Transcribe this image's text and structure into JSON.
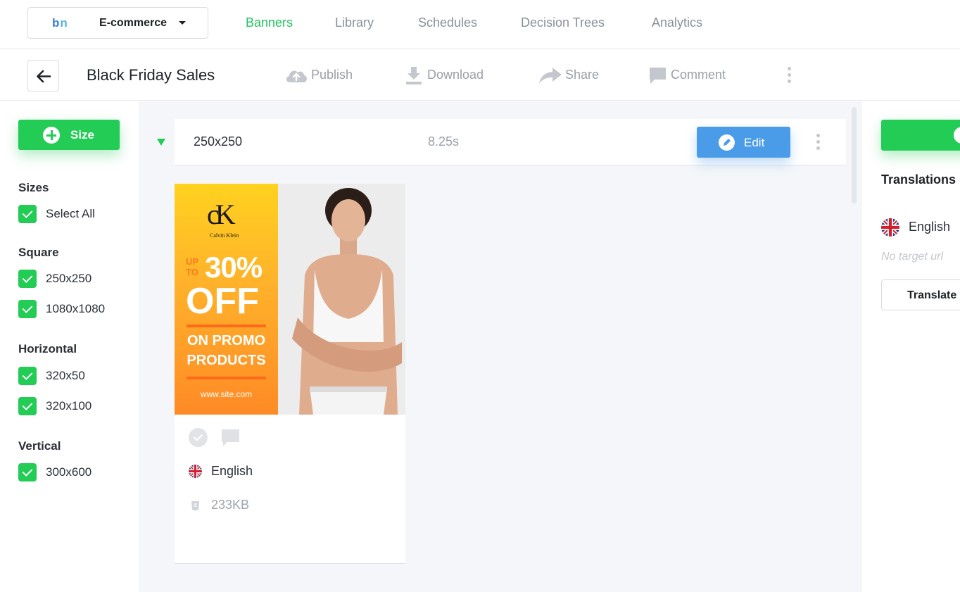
{
  "workspace": {
    "logo_b": "b",
    "logo_n": "n",
    "name": "E-commerce"
  },
  "nav": {
    "tabs": [
      {
        "label": "Banners",
        "active": true
      },
      {
        "label": "Library",
        "active": false
      },
      {
        "label": "Schedules",
        "active": false
      },
      {
        "label": "Decision Trees",
        "active": false
      },
      {
        "label": "Analytics",
        "active": false
      }
    ]
  },
  "toolbar": {
    "title": "Black Friday Sales",
    "publish": "Publish",
    "download": "Download",
    "share": "Share",
    "comment": "Comment"
  },
  "sidebar": {
    "size_button": "Size",
    "groups": [
      {
        "title": "Sizes",
        "items": [
          "Select All"
        ]
      },
      {
        "title": "Square",
        "items": [
          "250x250",
          "1080x1080"
        ]
      },
      {
        "title": "Horizontal",
        "items": [
          "320x50",
          "320x100"
        ]
      },
      {
        "title": "Vertical",
        "items": [
          "300x600"
        ]
      }
    ]
  },
  "main": {
    "size_row": {
      "size": "250x250",
      "duration": "8.25s",
      "edit_label": "Edit"
    },
    "card": {
      "banner": {
        "brand": "cK",
        "brand_sub": "Calvin Klein",
        "up": "UP",
        "to": "TO",
        "percent": "30%",
        "off": "OFF",
        "promo_line1": "ON PROMO",
        "promo_line2": "PRODUCTS",
        "site": "www.site.com"
      },
      "language": "English",
      "file_size": "233KB"
    }
  },
  "right_panel": {
    "title": "Translations",
    "language": "English",
    "no_url": "No target url",
    "translate_label": "Translate"
  },
  "colors": {
    "accent_green": "#22cc55",
    "nav_active": "#22c55e",
    "edit_blue": "#4a9be8"
  }
}
